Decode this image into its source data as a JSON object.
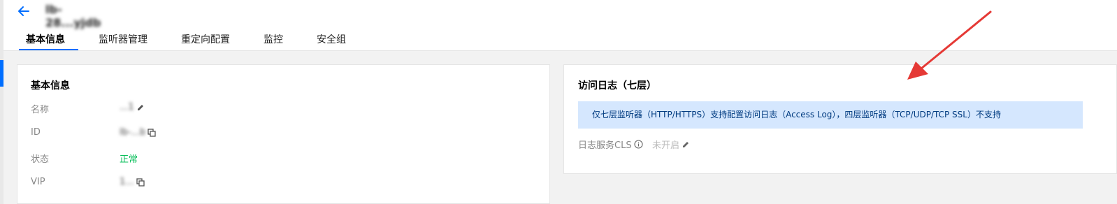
{
  "header": {
    "instance_name": "lb-28...yjdb",
    "tabs": [
      {
        "label": "基本信息",
        "active": true
      },
      {
        "label": "监听器管理"
      },
      {
        "label": "重定向配置"
      },
      {
        "label": "监控"
      },
      {
        "label": "安全组"
      }
    ]
  },
  "basic_info": {
    "title": "基本信息",
    "rows": [
      {
        "label": "名称",
        "value": "...1"
      },
      {
        "label": "ID",
        "value": "lb-...b"
      },
      {
        "label": "状态",
        "value": "正常"
      },
      {
        "label": "VIP",
        "value": "1..."
      }
    ]
  },
  "access_log": {
    "title": "访问日志（七层）",
    "notice": "仅七层监听器（HTTP/HTTPS）支持配置访问日志（Access Log），四层监听器（TCP/UDP/TCP SSL）不支持",
    "service_label": "日志服务CLS",
    "service_status": "未开启"
  },
  "colors": {
    "accent": "#006eff",
    "status_ok": "#0abf5b",
    "notice_bg": "#d5e7fe",
    "annotation_arrow": "#e53935"
  },
  "icons": [
    "back-arrow-icon",
    "edit-icon",
    "copy-icon",
    "info-icon",
    "annotation-arrow"
  ]
}
